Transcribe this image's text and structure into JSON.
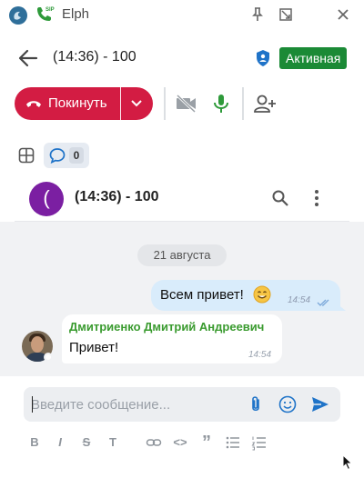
{
  "window": {
    "title": "Elph",
    "sip_label": "SIP"
  },
  "call": {
    "title": "(14:36) - 100",
    "status": "Активная",
    "leave_label": "Покинуть"
  },
  "chat_tools": {
    "unread_count": "0"
  },
  "chat": {
    "avatar_letter": "(",
    "title": "(14:36) - 100"
  },
  "messages": {
    "date": "21 августа",
    "outgoing": {
      "text": "Всем привет!",
      "time": "14:54"
    },
    "incoming": {
      "author": "Дмитриенко Дмитрий Андреевич",
      "text": "Привет!",
      "time": "14:54"
    }
  },
  "composer": {
    "placeholder": "Введите сообщение...",
    "value": ""
  },
  "formatting": {
    "bold": "B",
    "italic": "I",
    "strike": "S",
    "text": "T",
    "code": "<>",
    "quote": "”"
  },
  "colors": {
    "accent_red": "#d31c43",
    "status_green": "#1b8a36",
    "author_green": "#3a9b2f",
    "link_blue": "#1f73c8",
    "avatar_purple": "#7b1fa2"
  },
  "icons": [
    "app-logo-icon",
    "phone-sip-icon",
    "pin-icon",
    "collapse-icon",
    "close-icon",
    "back-arrow-icon",
    "shield-icon",
    "hang-up-icon",
    "chevron-down-icon",
    "camera-off-icon",
    "microphone-icon",
    "add-user-icon",
    "grid-icon",
    "chat-bubble-icon",
    "search-icon",
    "more-vertical-icon",
    "smile-emoji-icon",
    "double-check-icon",
    "attach-icon",
    "emoji-icon",
    "send-icon",
    "link-icon",
    "list-bullet-icon",
    "list-numbered-icon"
  ]
}
